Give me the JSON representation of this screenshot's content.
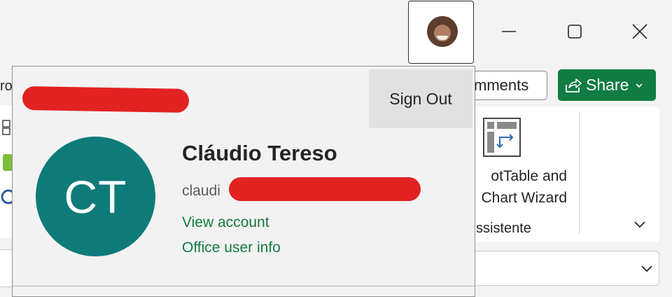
{
  "titlebar": {
    "minimize_icon": "minimize-icon",
    "maximize_icon": "maximize-icon",
    "close_icon": "close-icon"
  },
  "ribbon": {
    "comments_label": "mments",
    "share_label": "Share",
    "pivot_line1": "otTable and",
    "pivot_line2": "Chart Wizard",
    "group_label": "ssistente",
    "left_text": "ro"
  },
  "account": {
    "signout_label": "Sign Out",
    "initials": "CT",
    "name": "Cláudio Tereso",
    "email_prefix": "claudi",
    "view_account": "View account",
    "office_user_info": "Office user info",
    "avatar_color": "#0e7b78"
  },
  "colors": {
    "accent_green": "#107c41",
    "link_green": "#137a3f",
    "redaction": "#e32222"
  }
}
